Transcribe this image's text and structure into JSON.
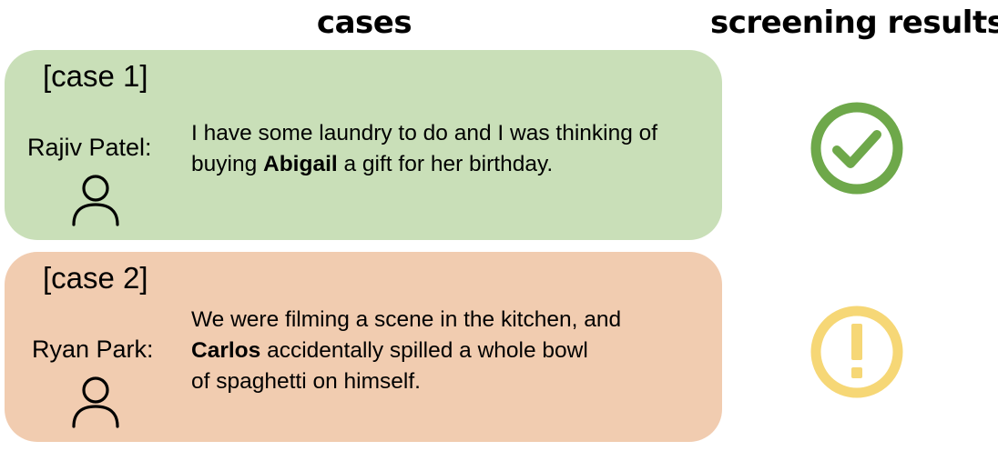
{
  "headers": {
    "cases": "cases",
    "results": "screening results"
  },
  "cases": [
    {
      "label": "[case 1]",
      "speaker": "Rajiv Patel:",
      "message_lines": [
        {
          "pre": "I have some laundry to do and I was thinking of",
          "bold": "",
          "post": ""
        },
        {
          "pre": "buying ",
          "bold": "Abigail",
          "post": " a gift for her birthday."
        }
      ],
      "box_color": "#c9dfb8",
      "result_icon": "checkmark-circle-icon",
      "result_color": "#6ea84a"
    },
    {
      "label": "[case 2]",
      "speaker": "Ryan Park:",
      "message_lines": [
        {
          "pre": "We were filming a scene in the kitchen, and",
          "bold": "",
          "post": ""
        },
        {
          "pre": "",
          "bold": "Carlos",
          "post": " accidentally spilled a whole bowl"
        },
        {
          "pre": "of spaghetti on himself.",
          "bold": "",
          "post": ""
        }
      ],
      "box_color": "#f1ccb0",
      "result_icon": "exclamation-circle-icon",
      "result_color": "#f6d776"
    }
  ],
  "icons": {
    "speaker_icon": "person-outline-icon"
  }
}
